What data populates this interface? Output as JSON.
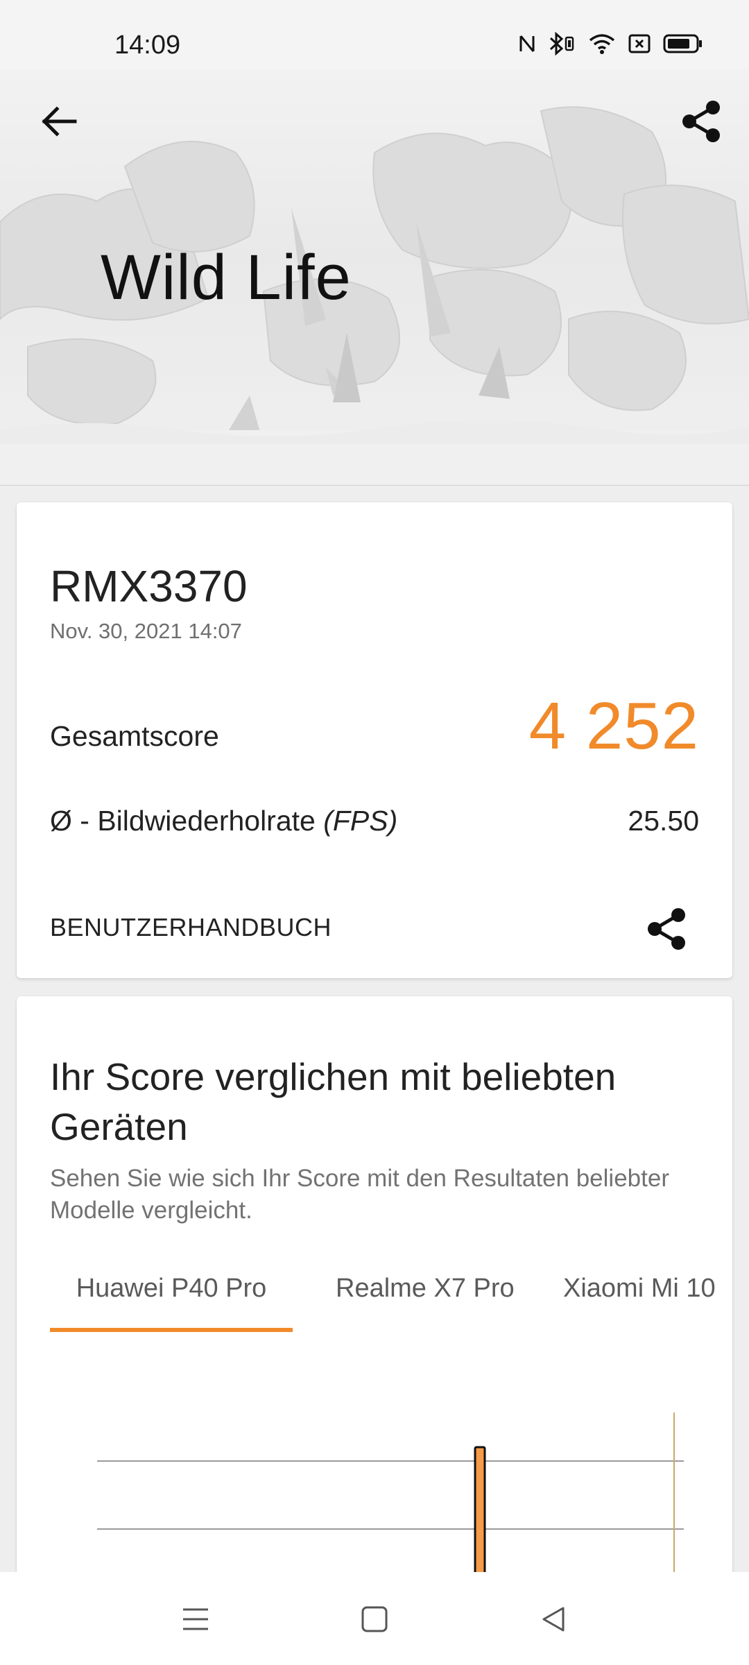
{
  "status_bar": {
    "time": "14:09",
    "icons": [
      "nfc-icon",
      "bluetooth-icon",
      "wifi-icon",
      "sim-off-icon",
      "battery-icon"
    ]
  },
  "header": {
    "title": "Wild Life",
    "back_icon": "arrow-left-icon",
    "share_icon": "share-icon"
  },
  "result": {
    "device": "RMX3370",
    "date": "Nov. 30, 2021 14:07",
    "score_label": "Gesamtscore",
    "score_value": "4 252",
    "fps_label_prefix": "Ø - Bildwiederholrate ",
    "fps_label_unit": "(FPS)",
    "fps_value": "25.50",
    "manual_label": "BENUTZERHANDBUCH",
    "accent_color": "#f18a2a"
  },
  "compare": {
    "title": "Ihr Score verglichen mit beliebten Geräten",
    "subtitle": "Sehen Sie wie sich Ihr Score mit den Resultaten beliebter Modelle vergleicht.",
    "tabs": [
      {
        "label": "Huawei P40 Pro",
        "active": true
      },
      {
        "label": "Realme X7 Pro",
        "active": false
      },
      {
        "label": "Xiaomi Mi 10",
        "active": false
      }
    ]
  },
  "nav_bar": {
    "icons": [
      "menu-icon",
      "home-icon",
      "back-triangle-icon"
    ]
  }
}
